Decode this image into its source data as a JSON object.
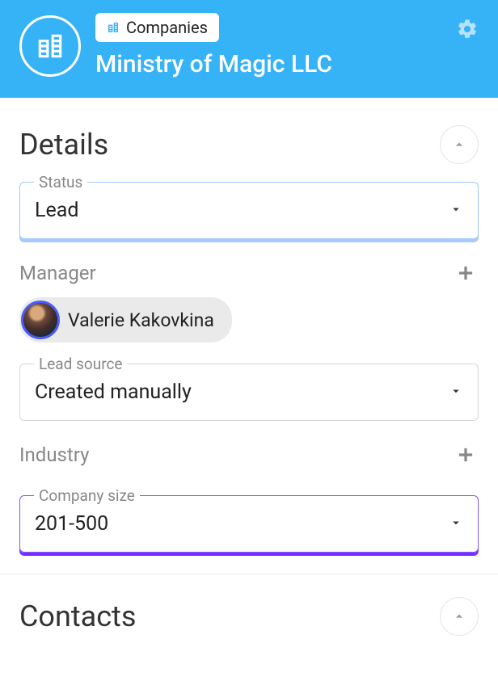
{
  "header": {
    "chip_label": "Companies",
    "company_name": "Ministry of Magic LLC"
  },
  "details": {
    "title": "Details",
    "status": {
      "label": "Status",
      "value": "Lead"
    },
    "manager": {
      "label": "Manager",
      "name": "Valerie Kakovkina"
    },
    "lead_source": {
      "label": "Lead source",
      "value": "Created manually"
    },
    "industry": {
      "label": "Industry"
    },
    "company_size": {
      "label": "Company size",
      "value": "201-500"
    }
  },
  "contacts": {
    "title": "Contacts"
  }
}
